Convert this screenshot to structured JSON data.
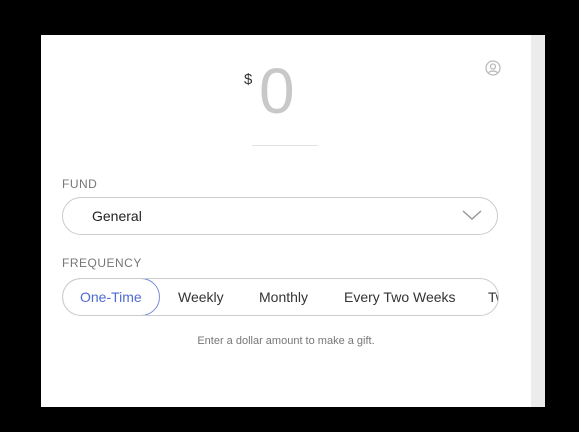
{
  "amount": {
    "currency": "$",
    "value": "0"
  },
  "fund": {
    "label": "FUND",
    "selected": "General"
  },
  "frequency": {
    "label": "FREQUENCY",
    "options": [
      "One-Time",
      "Weekly",
      "Monthly",
      "Every Two Weeks",
      "Tw"
    ],
    "selected": "One-Time"
  },
  "hint": "Enter a dollar amount to make a gift.",
  "colors": {
    "accent": "#4f6bd1",
    "amount_placeholder": "#c8c8c8"
  },
  "icons": [
    "user-icon",
    "chevron-down-icon"
  ]
}
